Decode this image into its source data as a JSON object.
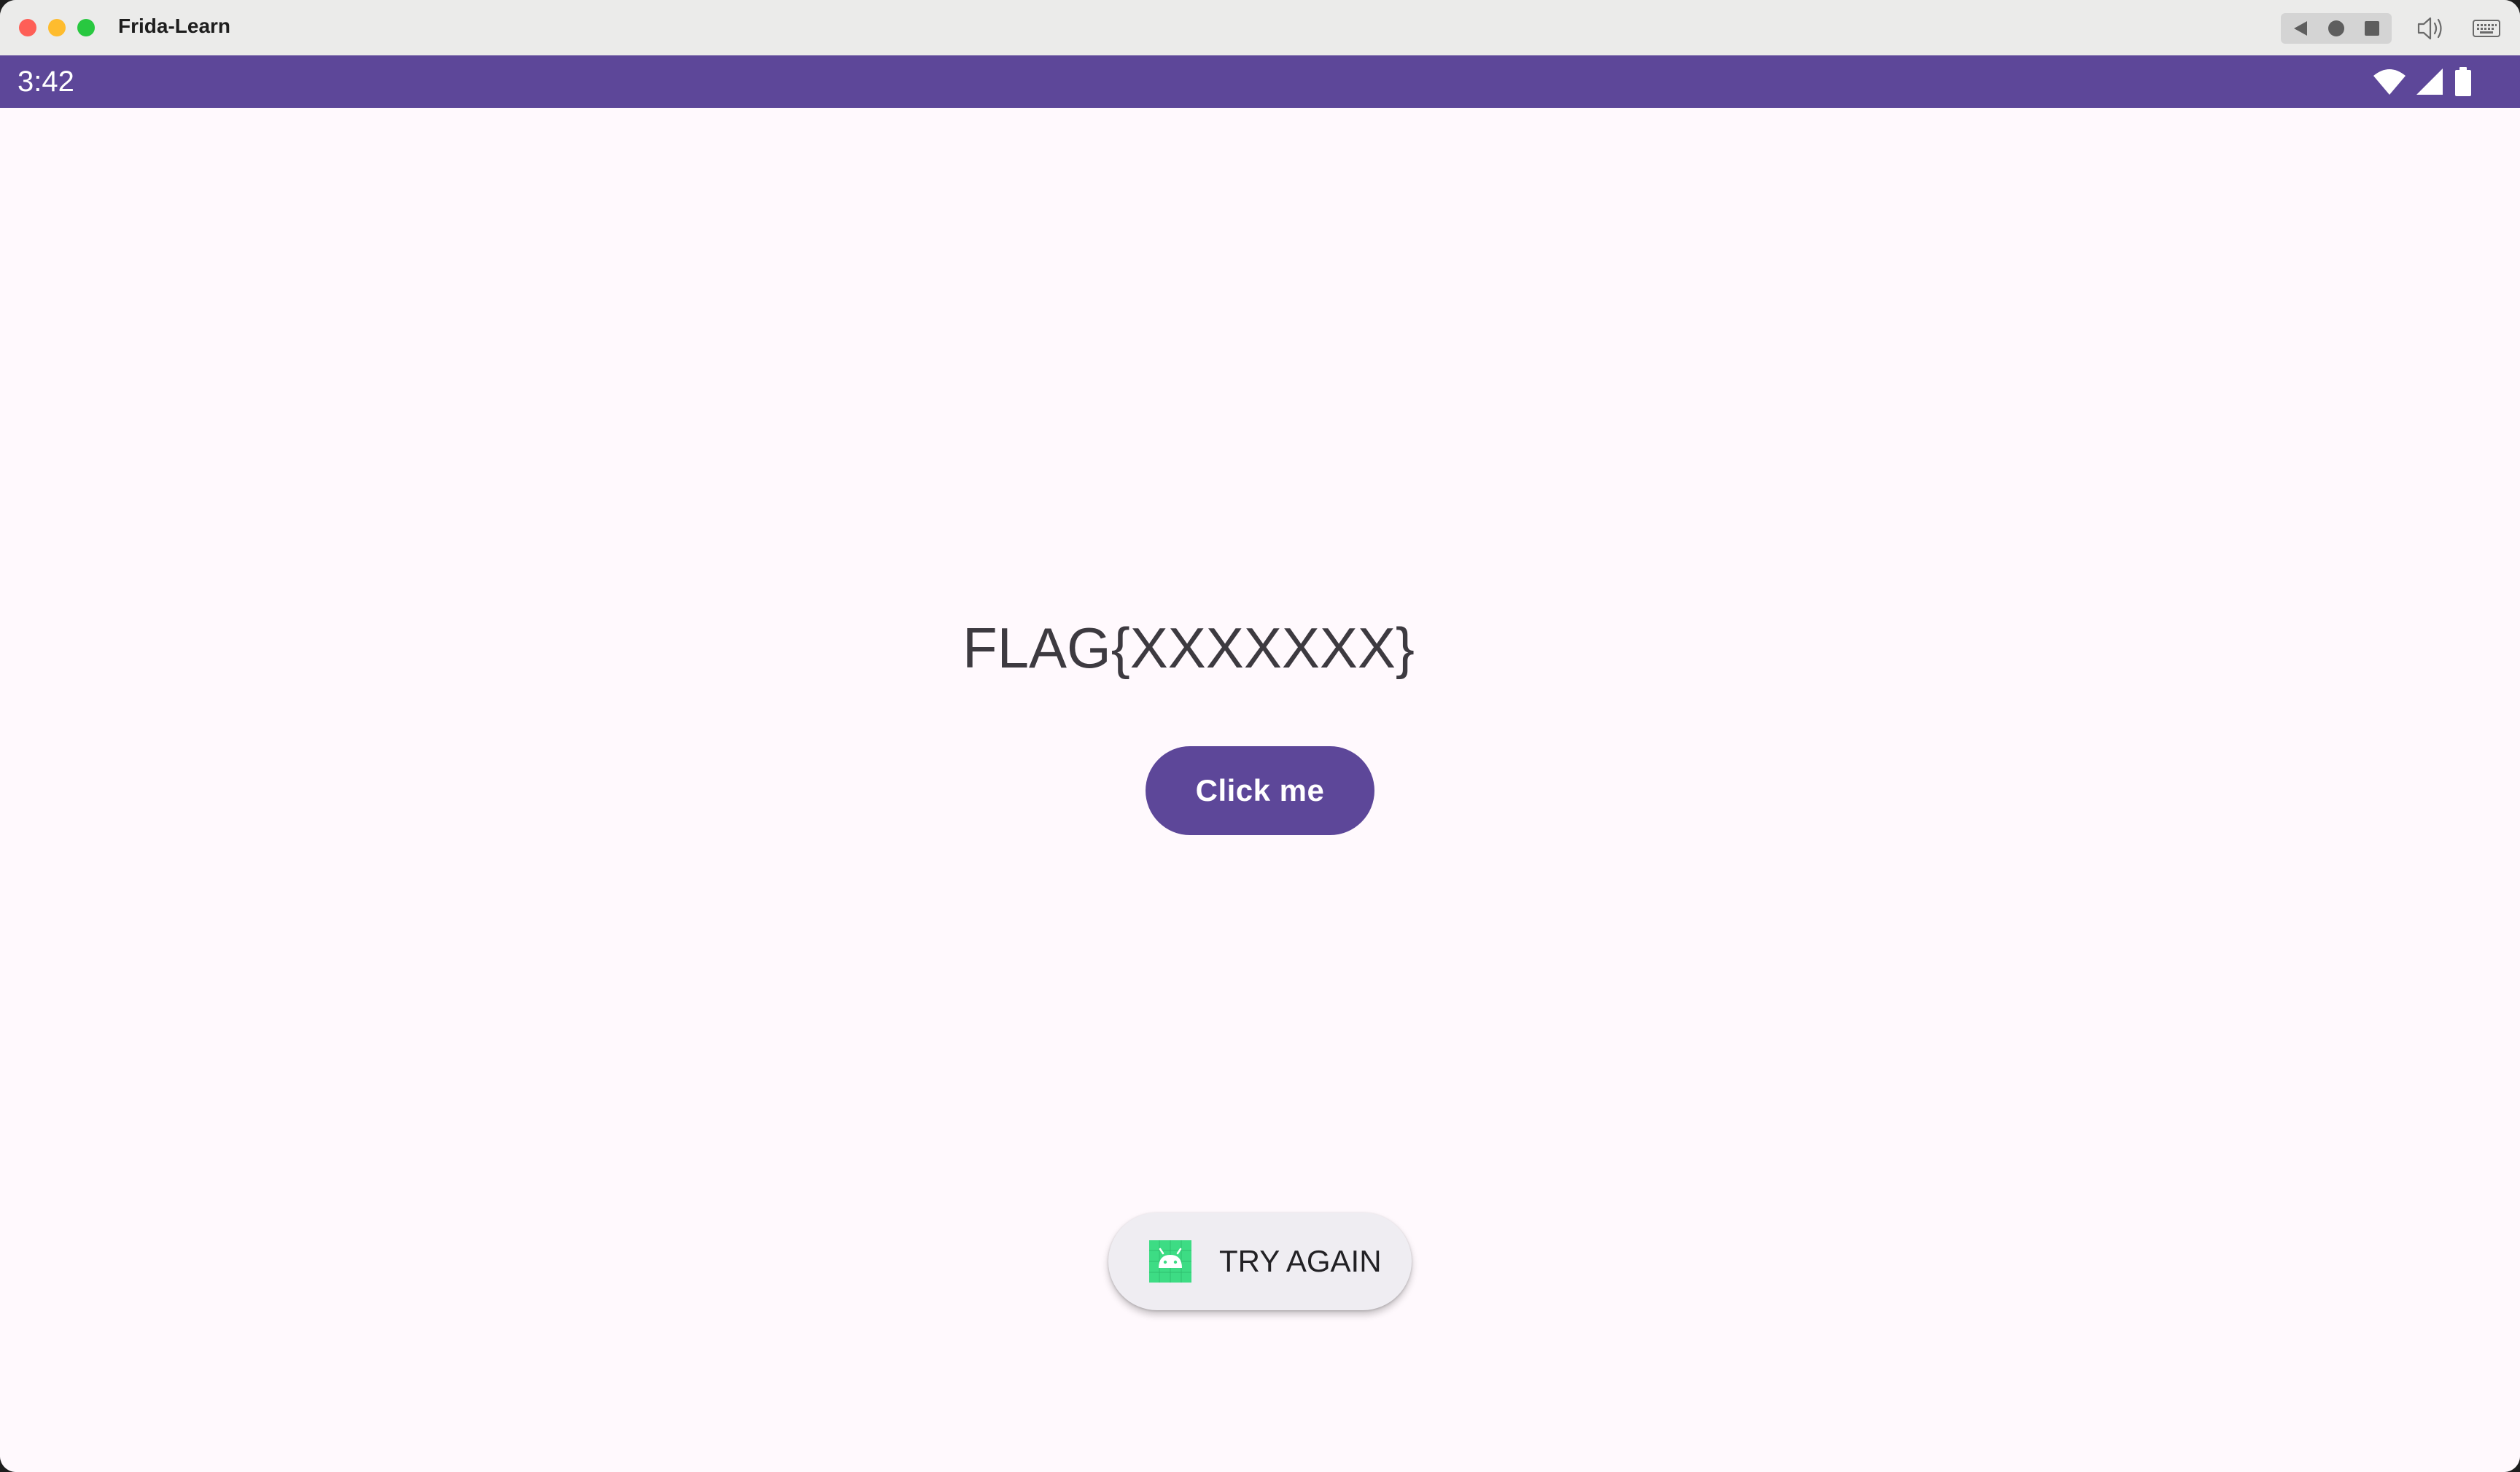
{
  "window": {
    "title": "Frida-Learn"
  },
  "toolbar": {
    "icons": [
      "back-icon",
      "home-icon",
      "overview-icon",
      "volume-icon",
      "keyboard-icon"
    ]
  },
  "status_bar": {
    "time": "3:42",
    "icons": [
      "wifi-icon",
      "signal-icon",
      "battery-icon"
    ],
    "color": "#5d4799"
  },
  "main": {
    "flag_text": "FLAG{XXXXXXX}",
    "button_label": "Click me",
    "button_color": "#5d4799"
  },
  "toast": {
    "icon": "android-app-icon",
    "message": "TRY AGAIN"
  }
}
